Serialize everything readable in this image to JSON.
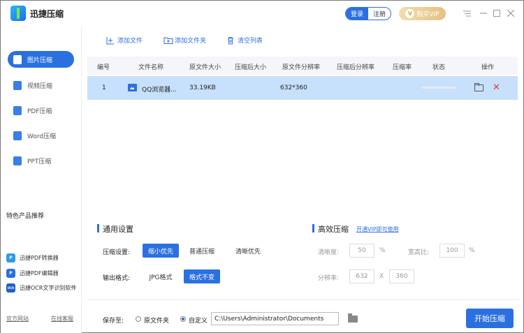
{
  "app": {
    "title": "迅捷压缩"
  },
  "header": {
    "login": "登录",
    "register": "注册",
    "vip_label": "购买VIP",
    "vip_badge": "V"
  },
  "window_controls": [
    "menu-icon",
    "minimize-icon",
    "maximize-icon",
    "close-icon"
  ],
  "sidebar": {
    "items": [
      {
        "label": "图片压缩",
        "active": true,
        "icon": "image-icon"
      },
      {
        "label": "视频压缩",
        "active": false,
        "icon": "video-icon"
      },
      {
        "label": "PDF压缩",
        "active": false,
        "icon": "pdf-icon"
      },
      {
        "label": "Word压缩",
        "active": false,
        "icon": "word-icon"
      },
      {
        "label": "PPT压缩",
        "active": false,
        "icon": "ppt-icon"
      }
    ],
    "featured_title": "特色产品推荐",
    "featured": [
      {
        "label": "迅捷PDF转换器",
        "icon_text": "P",
        "color": "#2b9be8"
      },
      {
        "label": "迅捷PDF编辑器",
        "icon_text": "P",
        "color": "#2b70e0"
      },
      {
        "label": "迅捷OCR文字识别软件",
        "icon_text": "OCR",
        "color": "#1f5fc8"
      }
    ],
    "links": {
      "website": "官方网站",
      "support": "在线客服"
    }
  },
  "toolbar": {
    "add_file": "添加文件",
    "add_folder": "添加文件夹",
    "clear_list": "清空列表"
  },
  "table": {
    "headers": [
      "编号",
      "文件名称",
      "原文件大小",
      "压缩后大小",
      "原文件分辨率",
      "压缩后分辨率",
      "压缩率",
      "状态",
      "操作"
    ],
    "rows": [
      {
        "index": "1",
        "name": "QQ浏览器...",
        "orig_size": "33.19KB",
        "comp_size": "",
        "orig_res": "632*360",
        "comp_res": "",
        "ratio": "",
        "progress": 0
      }
    ]
  },
  "settings": {
    "general_title": "通用设置",
    "compress_label": "压缩设置:",
    "compress_options": [
      "缩小优先",
      "普通压缩",
      "清晰优先"
    ],
    "compress_selected": 0,
    "format_label": "输出格式:",
    "format_options": [
      "JPG格式",
      "格式不变"
    ],
    "format_selected": 1,
    "efficient_title": "高效压缩",
    "vip_link": "开通VIP即可使用",
    "clarity_label": "清晰度:",
    "clarity_value": "50",
    "clarity_unit": "%",
    "aspect_label": "宽高比:",
    "aspect_value": "100",
    "aspect_unit": "%",
    "resolution_label": "分辨率:",
    "res_w": "632",
    "res_sep": "X",
    "res_h": "360"
  },
  "bottom": {
    "save_label": "保存至:",
    "option_original": "原文件夹",
    "option_custom": "自定义",
    "selected": "custom",
    "path": "C:\\Users\\Administrator\\Documents",
    "start": "开始压缩"
  },
  "colors": {
    "accent": "#2b70e0",
    "row_selected": "#c7e0fb",
    "danger": "#e03b3b",
    "vip": "#e6c183"
  }
}
